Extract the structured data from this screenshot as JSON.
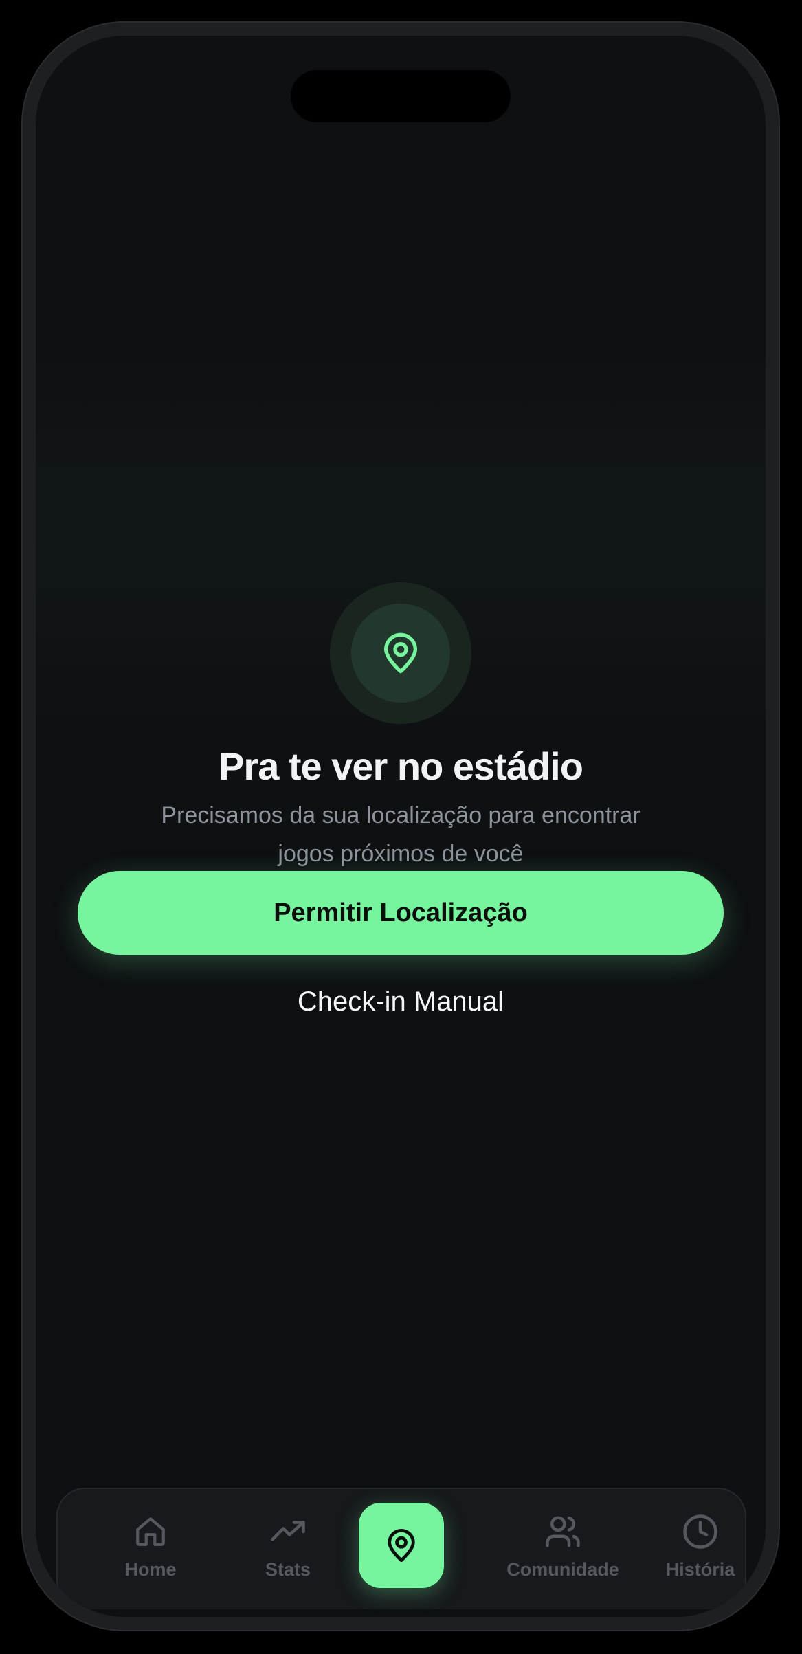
{
  "screen": {
    "title": "Pra te ver no estádio",
    "subtitle": "Precisamos da sua localização para encontrar jogos próximos de você",
    "hero_icon": "map-pin-icon",
    "primary_action": "Permitir Localização",
    "secondary_action": "Check-in Manual"
  },
  "tabbar": {
    "items": [
      {
        "label": "Home",
        "icon": "home-icon"
      },
      {
        "label": "Stats",
        "icon": "trending-up-icon"
      },
      {
        "label": "",
        "icon": "map-pin-icon",
        "active": true
      },
      {
        "label": "Comunidade",
        "icon": "users-icon"
      },
      {
        "label": "História",
        "icon": "clock-icon"
      }
    ]
  },
  "colors": {
    "accent": "#76f59e",
    "background": "#0e1012",
    "text_primary": "#f2f3f4",
    "text_secondary": "#8d939b",
    "tab_inactive": "#55595f"
  }
}
